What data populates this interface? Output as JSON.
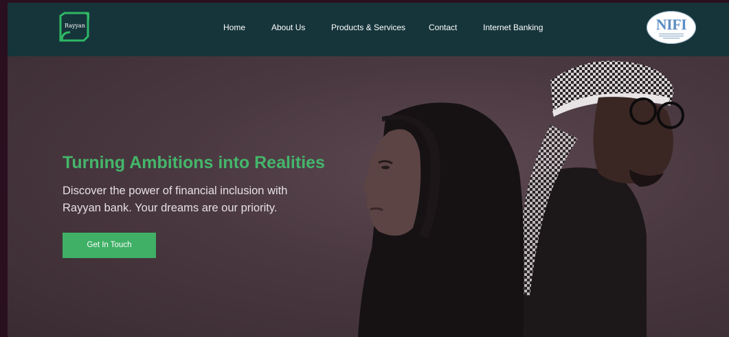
{
  "header": {
    "logo_text": "Rayyan",
    "nav": {
      "home": "Home",
      "about": "About Us",
      "products": "Products & Services",
      "contact": "Contact",
      "banking": "Internet Banking"
    },
    "partner_logo": "NIFI"
  },
  "hero": {
    "title": "Turning Ambitions into Realities",
    "subtitle": "Discover the power of financial inclusion with Rayyan bank. Your dreams are our priority.",
    "cta_label": "Get In Touch"
  },
  "colors": {
    "header_bg": "#16353b",
    "accent_green": "#45b66b",
    "hero_bg": "#4a3840"
  },
  "icons": {
    "logo": "rayyan-logo-icon",
    "partner": "nifi-logo-icon"
  }
}
